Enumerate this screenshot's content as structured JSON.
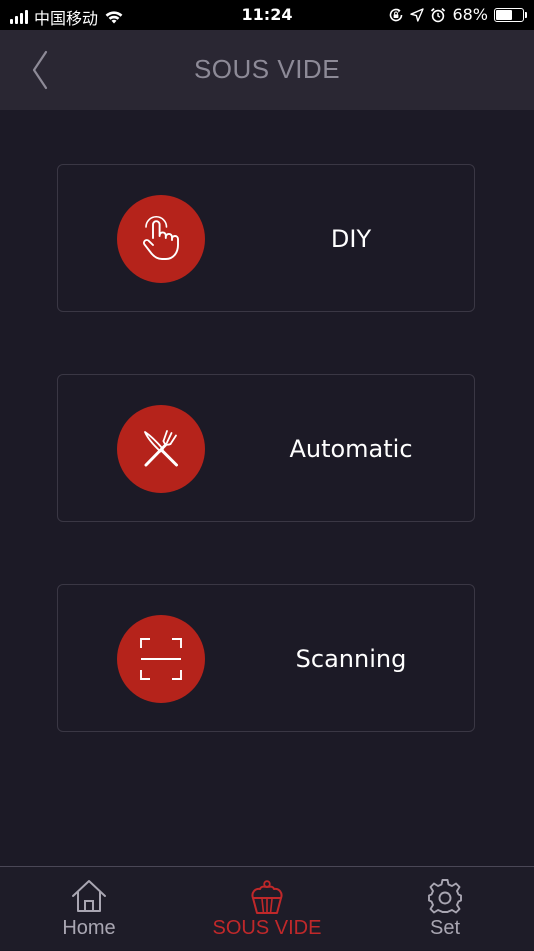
{
  "status_bar": {
    "carrier": "中国移动",
    "time": "11:24",
    "battery_percent": "68%",
    "battery_level": 0.68,
    "icons": [
      "signal-icon",
      "wifi-icon",
      "rotation-lock-icon",
      "location-icon",
      "alarm-icon",
      "battery-icon"
    ]
  },
  "header": {
    "title": "SOUS VIDE",
    "back_icon": "chevron-left-icon"
  },
  "options": [
    {
      "label": "DIY",
      "icon": "hand-pointer-icon"
    },
    {
      "label": "Automatic",
      "icon": "fork-knife-icon"
    },
    {
      "label": "Scanning",
      "icon": "scan-frame-icon"
    }
  ],
  "tabs": [
    {
      "label": "Home",
      "icon": "home-icon",
      "active": false
    },
    {
      "label": "SOUS VIDE",
      "icon": "cupcake-icon",
      "active": true
    },
    {
      "label": "Set",
      "icon": "gear-icon",
      "active": false
    }
  ],
  "colors": {
    "background": "#1c1a26",
    "header": "#2a2733",
    "accent": "#b5231b",
    "active_tab": "#c0282a",
    "inactive_tab": "#a9a6b2",
    "title": "#8d8a97"
  }
}
